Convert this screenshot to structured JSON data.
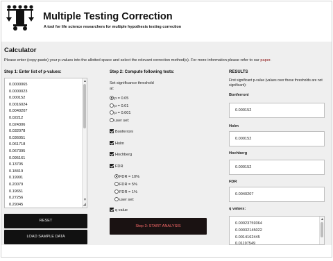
{
  "header": {
    "title": "Multiple Testing Correction",
    "subtitle": "A tool for life science researchers for multiple hypothesis testing correction",
    "logo_icon": "scales-logo-icon"
  },
  "calculator": {
    "title": "Calculator",
    "intro": "Please enter (copy-paste) your p-values into the allotted space and select the relevant correction method(s). For more information please refer to our",
    "intro_link": "paper"
  },
  "step1": {
    "heading": "Step 1: Enter list of p-values:",
    "pvalues": [
      "0.0000065",
      "0.0000023",
      "0.000152",
      "0.0016024",
      "0.0040207",
      "0.02212",
      "0.024306",
      "0.032078",
      "0.036051",
      "0.061718",
      "0.067395",
      "0.095161",
      "0.13705",
      "0.18419",
      "0.19991",
      "0.20079",
      "0.19651",
      "0.27256",
      "0.29045",
      "0.31917"
    ],
    "reset_label": "RESET",
    "load_label": "LOAD SAMPLE DATA"
  },
  "step2": {
    "heading": "Step 2: Compute following tests:",
    "threshold_label_1": "Set significance threshold",
    "threshold_label_2": "at:",
    "thresholds": [
      {
        "label": "p = 0.05",
        "selected": true
      },
      {
        "label": "p = 0.01",
        "selected": false
      },
      {
        "label": "p = 0.001",
        "selected": false
      },
      {
        "label": "user set:",
        "selected": false
      }
    ],
    "tests": [
      {
        "label": "Bonferroni",
        "checked": true
      },
      {
        "label": "Holm",
        "checked": true
      },
      {
        "label": "Hochberg",
        "checked": true
      },
      {
        "label": "FDR",
        "checked": true
      }
    ],
    "fdr_options": [
      {
        "label": "FDR = 10%",
        "selected": true
      },
      {
        "label": "FDR = 5%",
        "selected": false
      },
      {
        "label": "FDR = 1%",
        "selected": false
      },
      {
        "label": "user set:",
        "selected": false
      }
    ],
    "qvalue_label": "q value",
    "qvalue_checked": true,
    "start_label": "Step 3: START ANALYSIS"
  },
  "results": {
    "heading": "RESULTS",
    "note_1": "First significant p-value (values over these thresholds are not",
    "note_2": "significant):",
    "bonferroni_label": "Bonferroni",
    "bonferroni_value": "0.000152",
    "holm_label": "Holm",
    "holm_value": "0.000152",
    "hochberg_label": "Hochberg",
    "hochberg_value": "0.000152",
    "fdr_label": "FDR",
    "fdr_value": "0.0040207",
    "qvalues_label": "q values:",
    "qvalues": [
      "0.00023759364",
      "0.00032145022",
      "0.0014162445",
      "0.01197549"
    ]
  },
  "colors": {
    "band": "#efefef",
    "button_dark": "#111111",
    "start_text": "#ff6b6b",
    "link": "#8a1010"
  }
}
